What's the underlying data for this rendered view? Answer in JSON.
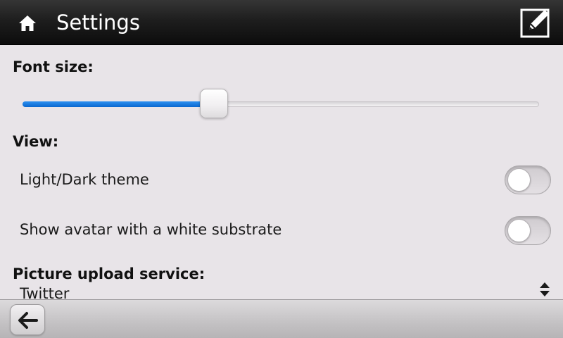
{
  "header": {
    "title": "Settings",
    "home_icon": "home-icon",
    "compose_icon": "edit-icon"
  },
  "font_size": {
    "label": "Font size:",
    "slider_value_fraction": 0.37
  },
  "view": {
    "label": "View:",
    "rows": [
      {
        "label": "Light/Dark theme",
        "enabled": false
      },
      {
        "label": "Show avatar with a white substrate",
        "enabled": false
      }
    ]
  },
  "picture_upload": {
    "label": "Picture upload service:",
    "selected": "Twitter"
  },
  "footer": {
    "back_icon": "back-arrow-icon"
  },
  "colors": {
    "accent": "#0a68cf",
    "header_bg": "#1e1e1e",
    "content_bg": "#e8e4e8"
  }
}
